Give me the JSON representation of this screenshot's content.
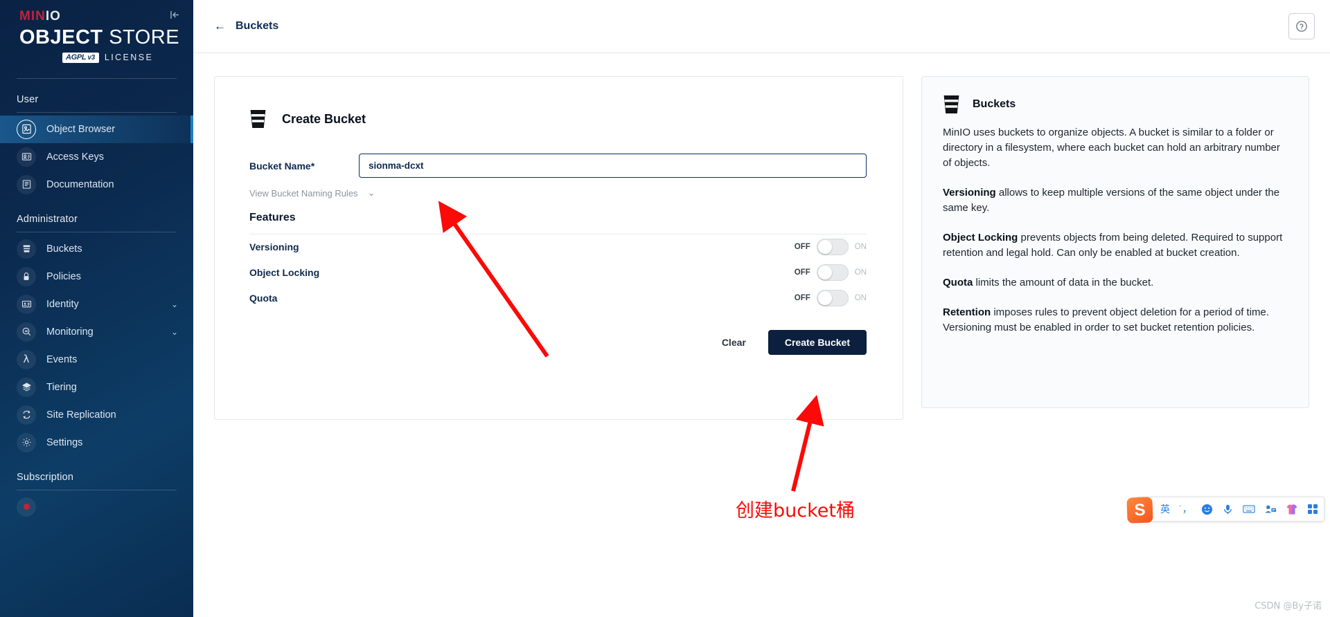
{
  "sidebar": {
    "logo": {
      "min": "MIN",
      "io": "IO",
      "object": "OBJECT",
      "store": " STORE",
      "license_badge": "AGPL",
      "license_badge_v": "v3",
      "license_text": "LICENSE"
    },
    "collapse_icon": "collapse-sidebar-icon",
    "sections": [
      {
        "title": "User",
        "items": [
          {
            "label": "Object Browser",
            "icon": "object-browser-icon",
            "active": true
          },
          {
            "label": "Access Keys",
            "icon": "access-keys-icon",
            "active": false
          },
          {
            "label": "Documentation",
            "icon": "documentation-icon",
            "active": false
          }
        ]
      },
      {
        "title": "Administrator",
        "items": [
          {
            "label": "Buckets",
            "icon": "bucket-icon",
            "active": false
          },
          {
            "label": "Policies",
            "icon": "lock-icon",
            "active": false
          },
          {
            "label": "Identity",
            "icon": "identity-icon",
            "active": false,
            "chevron": "⌄"
          },
          {
            "label": "Monitoring",
            "icon": "monitoring-icon",
            "active": false,
            "chevron": "⌄"
          },
          {
            "label": "Events",
            "icon": "lambda-icon",
            "active": false
          },
          {
            "label": "Tiering",
            "icon": "layers-icon",
            "active": false
          },
          {
            "label": "Site Replication",
            "icon": "replication-icon",
            "active": false
          },
          {
            "label": "Settings",
            "icon": "gear-icon",
            "active": false
          }
        ]
      },
      {
        "title": "Subscription",
        "items": []
      }
    ]
  },
  "topbar": {
    "back_arrow": "←",
    "breadcrumb": "Buckets",
    "help_icon": "help-circle-icon"
  },
  "form": {
    "icon": "bucket-icon",
    "title": "Create Bucket",
    "bucket_name_label": "Bucket Name*",
    "bucket_name_value": "sionma-dcxt",
    "bucket_name_placeholder": "",
    "naming_rules_label": "View Bucket Naming Rules",
    "naming_rules_chevron": "⌄",
    "features_heading": "Features",
    "toggles": [
      {
        "label": "Versioning",
        "off": "OFF",
        "on": "ON",
        "state": "off"
      },
      {
        "label": "Object Locking",
        "off": "OFF",
        "on": "ON",
        "state": "off"
      },
      {
        "label": "Quota",
        "off": "OFF",
        "on": "ON",
        "state": "off"
      }
    ],
    "clear_label": "Clear",
    "create_label": "Create Bucket"
  },
  "info": {
    "icon": "bucket-icon",
    "title": "Buckets",
    "paragraphs": [
      {
        "bold": "",
        "text": "MinIO uses buckets to organize objects. A bucket is similar to a folder or directory in a filesystem, where each bucket can hold an arbitrary number of objects."
      },
      {
        "bold": "Versioning",
        "text": " allows to keep multiple versions of the same object under the same key."
      },
      {
        "bold": "Object Locking",
        "text": " prevents objects from being deleted. Required to support retention and legal hold. Can only be enabled at bucket creation."
      },
      {
        "bold": "Quota",
        "text": " limits the amount of data in the bucket."
      },
      {
        "bold": "Retention",
        "text": " imposes rules to prevent object deletion for a period of time. Versioning must be enabled in order to set bucket retention policies."
      }
    ]
  },
  "annotations": {
    "chinese_note": "创建bucket桶",
    "arrow_color": "#fb0a07"
  },
  "ime": {
    "logo": "S",
    "items": [
      {
        "label": "英",
        "name": "ime-language-mode"
      },
      {
        "label": "˙，",
        "name": "ime-punctuation-toggle"
      },
      {
        "label": "☺",
        "name": "ime-emoji-icon"
      },
      {
        "label": "🎤",
        "name": "ime-voice-icon"
      },
      {
        "label": "⌨",
        "name": "ime-keyboard-icon"
      },
      {
        "label": "👤",
        "name": "ime-account-icon"
      },
      {
        "label": "👕",
        "name": "ime-skin-icon"
      },
      {
        "label": "☰",
        "name": "ime-menu-icon"
      }
    ]
  },
  "watermark": "CSDN @By子诺"
}
